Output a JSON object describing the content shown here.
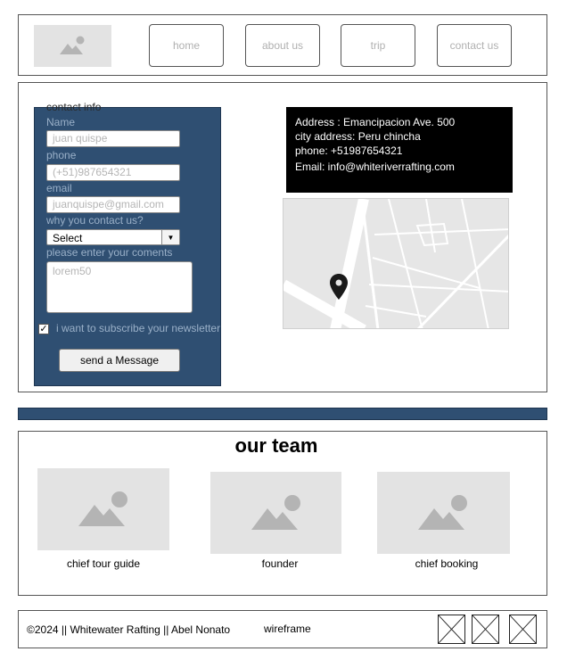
{
  "header": {
    "nav": [
      {
        "label": "home"
      },
      {
        "label": "about us"
      },
      {
        "label": "trip"
      },
      {
        "label": "contact us"
      }
    ]
  },
  "contact_form": {
    "title": "contact info",
    "name_label": "Name",
    "name_placeholder": "juan quispe",
    "phone_label": "phone",
    "phone_placeholder": "(+51)987654321",
    "email_label": "email",
    "email_placeholder": "juanquispe@gmail.com",
    "reason_label": "why you contact us?",
    "reason_selected": "Select",
    "comments_label": "please enter your coments",
    "comments_placeholder": "lorem50",
    "newsletter_checked": true,
    "newsletter_label": "i want to subscribe your newsletter",
    "submit_label": "send a Message"
  },
  "address": {
    "line1": "Address : Emancipacion Ave. 500",
    "line2": "city address: Peru chincha",
    "line3": "phone: +51987654321",
    "line4": "Email: info@whiteriverrafting.com"
  },
  "map": {
    "icon": "map-pin-icon"
  },
  "team": {
    "title": "our team",
    "members": [
      {
        "caption": "chief tour guide"
      },
      {
        "caption": "founder"
      },
      {
        "caption": "chief booking"
      }
    ]
  },
  "footer": {
    "copyright": "©2024 || Whitewater Rafting || Abel Nonato",
    "note": "wireframe",
    "icons": [
      "placeholder-icon",
      "placeholder-icon",
      "placeholder-icon"
    ]
  },
  "colors": {
    "panel": "#2f4f72",
    "placeholder": "#e3e3e3",
    "address_bg": "#000000"
  }
}
